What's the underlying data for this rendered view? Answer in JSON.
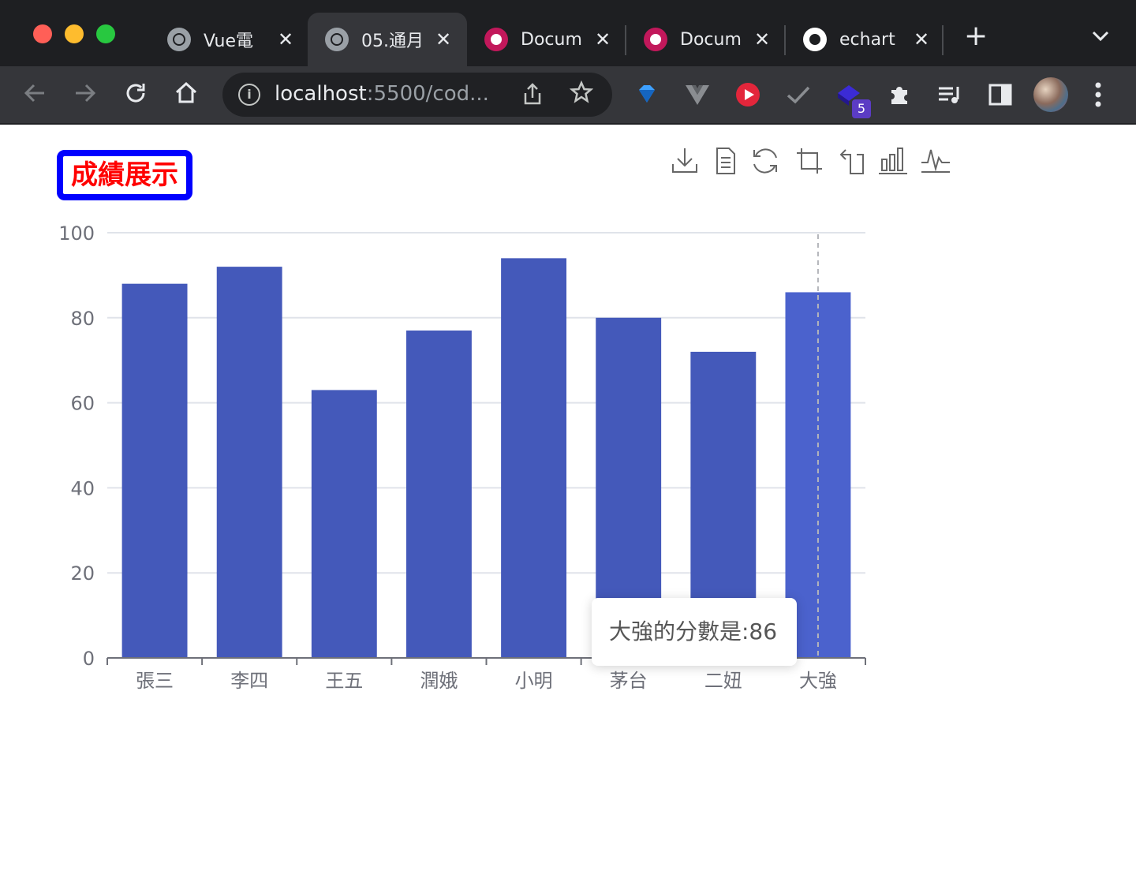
{
  "browser": {
    "tabs": [
      {
        "title": "Vue電",
        "favicon": "globe-icon",
        "active": false
      },
      {
        "title": "05.通月",
        "favicon": "globe-icon",
        "active": true
      },
      {
        "title": "Docum",
        "favicon": "document-icon",
        "active": false
      },
      {
        "title": "Docum",
        "favicon": "document-icon",
        "active": false
      },
      {
        "title": "echart",
        "favicon": "github-icon",
        "active": false
      }
    ],
    "close_glyph": "✕",
    "newtab_glyph": "+",
    "address": {
      "host": "localhost",
      "rest": ":5500/cod..."
    },
    "extension_badge": "5"
  },
  "page": {
    "title": "成績展示",
    "toolbox": [
      "save-image-icon",
      "data-view-icon",
      "restore-icon",
      "zoom-icon",
      "zoom-back-icon",
      "bar-switch-icon",
      "line-switch-icon"
    ],
    "tooltip": "大強的分數是:86"
  },
  "chart_data": {
    "type": "bar",
    "categories": [
      "張三",
      "李四",
      "王五",
      "潤娥",
      "小明",
      "茅台",
      "二妞",
      "大強"
    ],
    "values": [
      88,
      92,
      63,
      77,
      94,
      80,
      72,
      86
    ],
    "ylim": [
      0,
      100
    ],
    "yticks": [
      0,
      20,
      40,
      60,
      80,
      100
    ],
    "grid": true,
    "highlighted_index": 7,
    "colors": {
      "bar": "#4459ba",
      "bar_highlight": "#4b62cd",
      "grid": "#e0e3ea",
      "axis": "#6e7079",
      "label": "#6e7079"
    }
  }
}
